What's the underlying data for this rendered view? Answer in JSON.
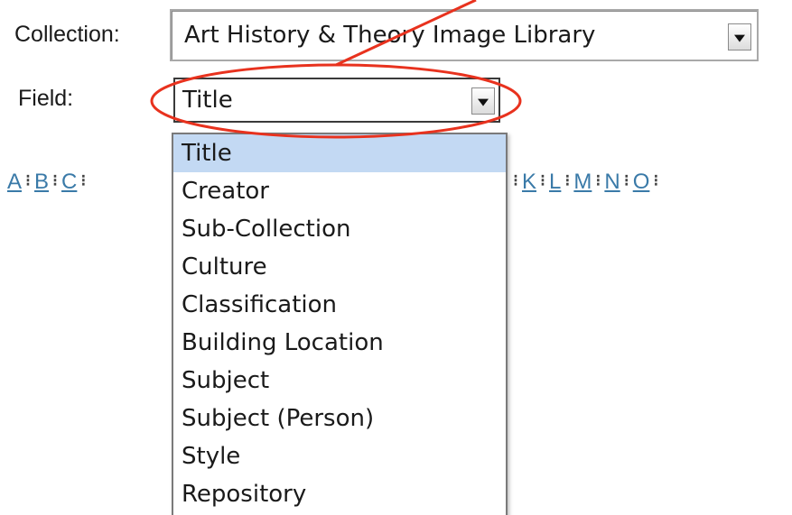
{
  "collection": {
    "label": "Collection:",
    "value": "Art History & Theory Image Library"
  },
  "field": {
    "label": "Field:",
    "value": "Title",
    "options": [
      "Title",
      "Creator",
      "Sub-Collection",
      "Culture",
      "Classification",
      "Building Location",
      "Subject",
      "Subject (Person)",
      "Style",
      "Repository"
    ]
  },
  "alphabet": {
    "left": [
      "A",
      "B",
      "C"
    ],
    "right": [
      "K",
      "L",
      "M",
      "N",
      "O"
    ]
  },
  "colors": {
    "annotation": "#e8321e",
    "selected_option": "#c3d9f3",
    "link": "#3a7aa8"
  }
}
